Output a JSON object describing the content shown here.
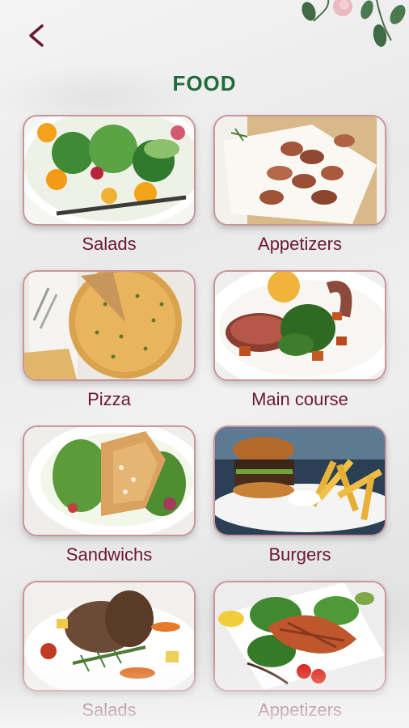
{
  "title": "FOOD",
  "back_icon": "chevron-left-icon",
  "decor_icon": "floral-decoration-icon",
  "colors": {
    "title": "#1f6b3a",
    "label": "#6b1830",
    "border": "#c9949a"
  },
  "categories": [
    {
      "label": "Salads"
    },
    {
      "label": "Appetizers"
    },
    {
      "label": "Pizza"
    },
    {
      "label": "Main course"
    },
    {
      "label": "Sandwichs"
    },
    {
      "label": "Burgers"
    },
    {
      "label": "Salads"
    },
    {
      "label": "Appetizers"
    }
  ]
}
